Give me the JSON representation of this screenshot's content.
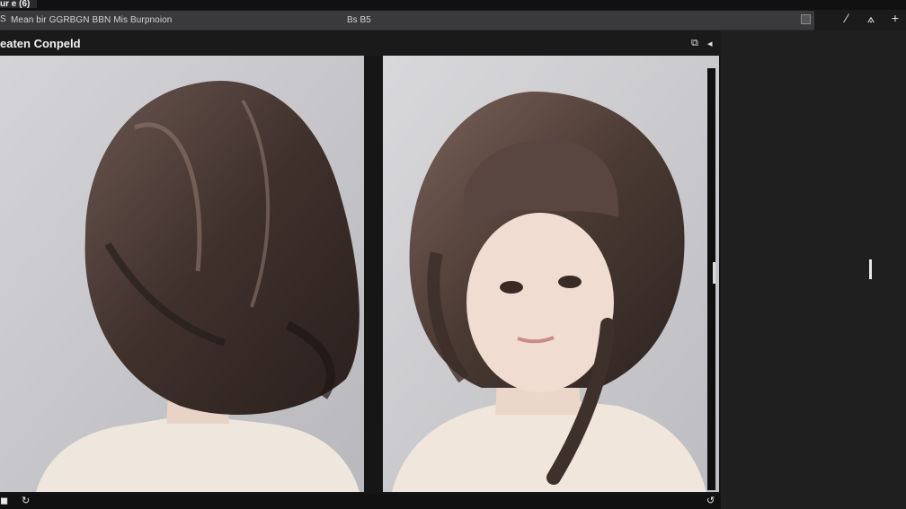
{
  "window": {
    "tab_label": "ur e (6)"
  },
  "urlbar": {
    "lead": "S",
    "url": "Mean bir GGRBGN BBN Mis Burpnoion",
    "page": "Bs B5"
  },
  "toolbar": {
    "pen_icon": "pen-icon",
    "share_icon": "share-icon",
    "add_icon": "add-icon",
    "pen_glyph": "⁄",
    "share_glyph": "⟑",
    "add_glyph": "+"
  },
  "titlebar": {
    "title": "eaten Conpeld",
    "fit_glyph": "⧉",
    "prev_glyph": "◂"
  },
  "gallery": {
    "images": [
      {
        "name": "back-view-photo",
        "desc": "bob-hair-back"
      },
      {
        "name": "front-view-photo",
        "desc": "bob-hair-front"
      }
    ]
  },
  "bottombar": {
    "left_glyph": "◼",
    "rotate_glyph": "↻",
    "right_glyph": "↺"
  },
  "colors": {
    "background": "#1b1b1c",
    "urlbar": "#3a3a3c",
    "panel": "#1f1f20",
    "hair": "#4a3a33"
  }
}
